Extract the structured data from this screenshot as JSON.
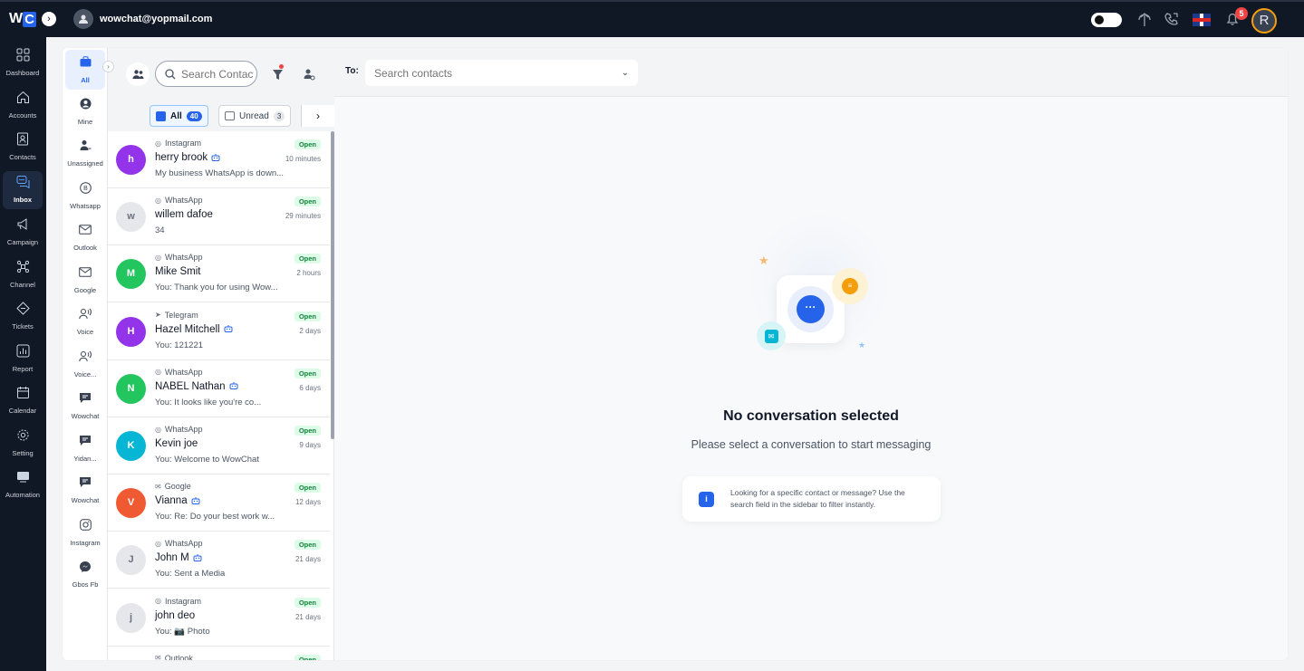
{
  "header": {
    "logo": {
      "w": "W",
      "c": "C"
    },
    "user_email": "wowchat@yopmail.com",
    "notification_count": "5",
    "avatar_initial": "R"
  },
  "nav": [
    {
      "label": "Dashboard",
      "icon": "dashboard-icon"
    },
    {
      "label": "Accounts",
      "icon": "home-icon"
    },
    {
      "label": "Contacts",
      "icon": "contacts-icon"
    },
    {
      "label": "Inbox",
      "icon": "inbox-icon",
      "active": true
    },
    {
      "label": "Campaign",
      "icon": "megaphone-icon"
    },
    {
      "label": "Channel",
      "icon": "network-icon"
    },
    {
      "label": "Tickets",
      "icon": "ticket-icon"
    },
    {
      "label": "Report",
      "icon": "report-icon"
    },
    {
      "label": "Calendar",
      "icon": "calendar-icon"
    },
    {
      "label": "Setting",
      "icon": "gear-icon"
    },
    {
      "label": "Automation",
      "icon": "automation-icon"
    }
  ],
  "channels": [
    {
      "label": "All",
      "icon": "briefcase-icon",
      "active": true
    },
    {
      "label": "Mine",
      "icon": "user-circle-icon"
    },
    {
      "label": "Unassigned",
      "icon": "user-minus-icon"
    },
    {
      "label": "Whatsapp",
      "icon": "whatsapp-icon"
    },
    {
      "label": "Outlook",
      "icon": "mail-icon"
    },
    {
      "label": "Google",
      "icon": "mail-icon"
    },
    {
      "label": "Voice",
      "icon": "voice-icon"
    },
    {
      "label": "Voice...",
      "icon": "voice-icon"
    },
    {
      "label": "Wowchat",
      "icon": "chat-icon"
    },
    {
      "label": "Yidan...",
      "icon": "chat-icon"
    },
    {
      "label": "Wowchat",
      "icon": "chat-icon"
    },
    {
      "label": "Instagram",
      "icon": "instagram-icon"
    },
    {
      "label": "Gbos Fb",
      "icon": "messenger-icon"
    }
  ],
  "list": {
    "search_placeholder": "Search Contacts",
    "tabs": [
      {
        "label": "All",
        "count": "40",
        "active": true
      },
      {
        "label": "Unread",
        "count": "3"
      }
    ],
    "conversations": [
      {
        "initial": "h",
        "color": "#9333ea",
        "source": "Instagram",
        "name": "herry brook",
        "bot": true,
        "preview": "My business WhatsApp is down...",
        "status": "Open",
        "time": "10 minutes"
      },
      {
        "initial": "w",
        "color": "#e5e7eb",
        "source": "WhatsApp",
        "name": "willem dafoe",
        "bot": false,
        "preview": "34",
        "status": "Open",
        "time": "29 minutes"
      },
      {
        "initial": "M",
        "color": "#22c55e",
        "source": "WhatsApp",
        "name": "Mike Smit",
        "bot": false,
        "preview": "You: Thank you for using Wow...",
        "status": "Open",
        "time": "2 hours"
      },
      {
        "initial": "H",
        "color": "#9333ea",
        "source": "Telegram",
        "name": "Hazel Mitchell",
        "bot": true,
        "preview": "You: 121221",
        "status": "Open",
        "time": "2 days"
      },
      {
        "initial": "N",
        "color": "#22c55e",
        "source": "WhatsApp",
        "name": "NABEL Nathan",
        "bot": true,
        "preview": "You: It looks like you're co...",
        "status": "Open",
        "time": "6 days"
      },
      {
        "initial": "K",
        "color": "#06b6d4",
        "source": "WhatsApp",
        "name": "Kevin joe",
        "bot": false,
        "preview": "You: Welcome to WowChat",
        "status": "Open",
        "time": "9 days"
      },
      {
        "initial": "V",
        "color": "#f05a33",
        "source": "Google",
        "name": "Vianna",
        "bot": true,
        "preview": "You: Re: Do your best work w...",
        "status": "Open",
        "time": "12 days"
      },
      {
        "initial": "J",
        "color": "#e5e7eb",
        "source": "WhatsApp",
        "name": "John M",
        "bot": true,
        "preview": "You: Sent a Media",
        "status": "Open",
        "time": "21 days"
      },
      {
        "initial": "j",
        "color": "#e5e7eb",
        "source": "Instagram",
        "name": "john deo",
        "bot": false,
        "preview": "You: 📷 Photo",
        "status": "Open",
        "time": "21 days"
      },
      {
        "initial": "",
        "color": "#e5e7eb",
        "source": "Outlook",
        "name": "",
        "bot": false,
        "preview": "",
        "status": "Open",
        "time": ""
      }
    ]
  },
  "compose": {
    "to_label": "To:",
    "to_placeholder": "Search contacts"
  },
  "empty_state": {
    "title": "No conversation selected",
    "subtitle": "Please select a conversation to start messaging",
    "hint": "Looking for a specific contact or message? Use the search field in the sidebar to filter instantly."
  }
}
